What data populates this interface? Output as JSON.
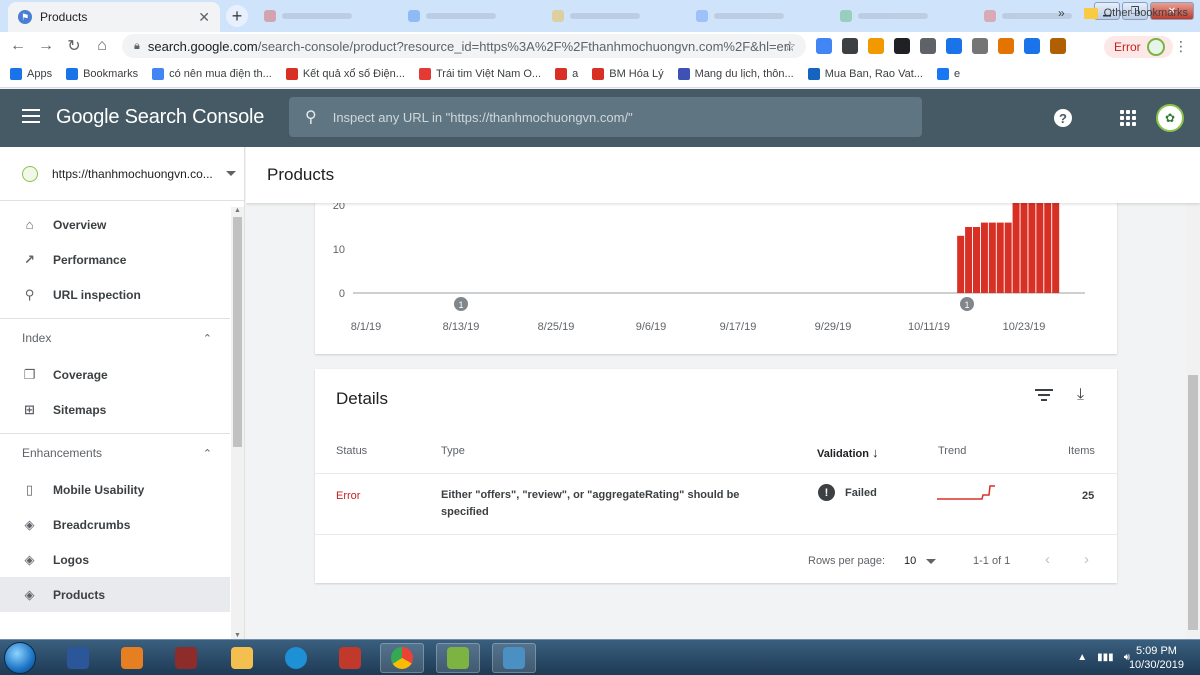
{
  "browser": {
    "active_tab_title": "Products",
    "url_host": "search.google.com",
    "url_path": "/search-console/product?resource_id=https%3A%2F%2Fthanhmochuongvn.com%2F&hl=en",
    "profile_status": "Error",
    "bookmarks": [
      {
        "label": "Apps",
        "icon": "apps-icon",
        "color": "#1a73e8"
      },
      {
        "label": "Bookmarks",
        "icon": "star-icon",
        "color": "#1a73e8"
      },
      {
        "label": "có nên mua điện th...",
        "icon": "google-icon",
        "color": "#4285f4"
      },
      {
        "label": "Kết quả xổ số Điện...",
        "icon": "lottery-icon",
        "color": "#d93025"
      },
      {
        "label": "Trái tim Việt Nam O...",
        "icon": "heart-icon",
        "color": "#e53935"
      },
      {
        "label": "a",
        "icon": "target-icon",
        "color": "#d93025"
      },
      {
        "label": "BM Hóa Lý",
        "icon": "g-red-icon",
        "color": "#d93025"
      },
      {
        "label": "Mang du lịch, thôn...",
        "icon": "calendar-icon",
        "color": "#3f51b5"
      },
      {
        "label": "Mua Ban, Rao Vat...",
        "icon": "s-icon",
        "color": "#1565c0"
      },
      {
        "label": "e",
        "icon": "facebook-icon",
        "color": "#1877f2"
      }
    ],
    "bookmarks_overflow": "»",
    "other_bookmarks": "Other bookmarks"
  },
  "header": {
    "product_name": "Google Search Console",
    "search_placeholder": "Inspect any URL in \"https://thanhmochuongvn.com/\""
  },
  "sidebar": {
    "property": "https://thanhmochuongvn.co...",
    "items_top": [
      {
        "label": "Overview",
        "icon": "home-icon",
        "glyph": "⌂"
      },
      {
        "label": "Performance",
        "icon": "trending-up-icon",
        "glyph": "↗"
      },
      {
        "label": "URL inspection",
        "icon": "search-icon",
        "glyph": "⚲"
      }
    ],
    "section_index": "Index",
    "items_index": [
      {
        "label": "Coverage",
        "icon": "coverage-icon",
        "glyph": "❐"
      },
      {
        "label": "Sitemaps",
        "icon": "sitemap-icon",
        "glyph": "⊞"
      }
    ],
    "section_enhancements": "Enhancements",
    "items_enh": [
      {
        "label": "Mobile Usability",
        "icon": "phone-icon",
        "glyph": "▯"
      },
      {
        "label": "Breadcrumbs",
        "icon": "layers-icon",
        "glyph": "◈"
      },
      {
        "label": "Logos",
        "icon": "layers-icon",
        "glyph": "◈"
      },
      {
        "label": "Products",
        "icon": "layers-icon",
        "glyph": "◈",
        "active": true
      }
    ]
  },
  "main": {
    "page_title": "Products",
    "details": {
      "title": "Details",
      "columns": {
        "status": "Status",
        "type": "Type",
        "validation": "Validation",
        "trend": "Trend",
        "items": "Items"
      },
      "rows": [
        {
          "status": "Error",
          "type": "Either \"offers\", \"review\", or \"aggregateRating\" should be specified",
          "validation": "Failed",
          "items": "25"
        }
      ],
      "rows_per_page_label": "Rows per page:",
      "rows_per_page_value": "10",
      "range": "1-1 of 1"
    }
  },
  "chart_data": {
    "type": "bar",
    "x_tick_labels": [
      "8/1/19",
      "8/13/19",
      "8/25/19",
      "9/6/19",
      "9/17/19",
      "9/29/19",
      "10/11/19",
      "10/23/19"
    ],
    "y_tick_labels": [
      "0",
      "10",
      "20"
    ],
    "ylim": [
      0,
      25
    ],
    "annotations": [
      {
        "label": "1",
        "at": "8/13/19"
      },
      {
        "label": "1",
        "at": "10/15/19"
      }
    ],
    "color": "#d93025",
    "x": [
      "10/15/19",
      "10/16/19",
      "10/17/19",
      "10/18/19",
      "10/19/19",
      "10/20/19",
      "10/21/19",
      "10/22/19",
      "10/23/19",
      "10/24/19",
      "10/25/19",
      "10/26/19",
      "10/27/19"
    ],
    "values": [
      13,
      15,
      15,
      16,
      16,
      16,
      16,
      21,
      21,
      21,
      21,
      21,
      21
    ]
  },
  "taskbar": {
    "time": "5:09 PM",
    "date": "10/30/2019"
  },
  "colors": {
    "header_bg": "#455a64",
    "error_red": "#c5221f",
    "bar_red": "#d93025"
  }
}
